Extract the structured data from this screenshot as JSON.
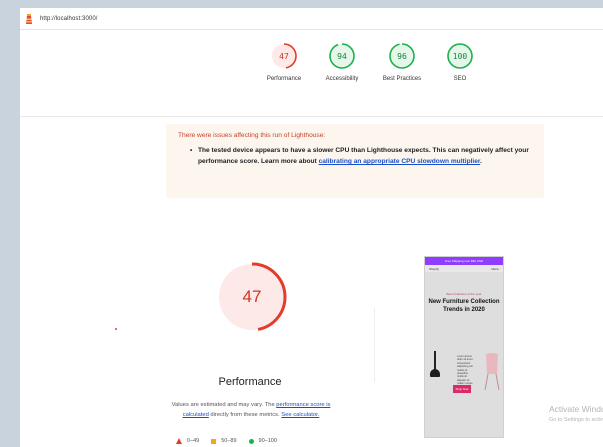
{
  "address_bar": {
    "url": "http://localhost:3000/"
  },
  "colors": {
    "fail": "#e43b2c",
    "average": "#f5a524",
    "pass": "#19b34a"
  },
  "gauges": [
    {
      "label": "Performance",
      "score": "47",
      "status": "fail"
    },
    {
      "label": "Accessibility",
      "score": "94",
      "status": "pass"
    },
    {
      "label": "Best Practices",
      "score": "96",
      "status": "pass"
    },
    {
      "label": "SEO",
      "score": "100",
      "status": "pass"
    }
  ],
  "warning": {
    "title": "There were issues affecting this run of Lighthouse:",
    "text": "The tested device appears to have a slower CPU than Lighthouse expects. This can negatively affect your performance score. Learn more about ",
    "link": "calibrating an appropriate CPU slowdown multiplier",
    "end": "."
  },
  "performance": {
    "score": "47",
    "title": "Performance",
    "note_1": "Values are estimated and may vary. The ",
    "note_link_1": "performance score is calculated",
    "note_2": " directly from these metrics. ",
    "note_link_2": "See calculator."
  },
  "legend": [
    {
      "icon": "triangle-icon",
      "range": "0–49"
    },
    {
      "icon": "square-icon",
      "range": "50–89"
    },
    {
      "icon": "circle-icon",
      "range": "90–100"
    }
  ],
  "screenshot": {
    "banner": "Free Shipping over $50 USD",
    "brand": "Shopify",
    "nav": "Menu",
    "subtitle": "Best Collection of the year",
    "heading": "New Furniture Collection Trends in 2020",
    "body": "Lorem ipsum dolor sit amet consectetur adipiscing elit mattis sit phasellus mollis sit aliquam sit nullam neque ultrices.",
    "button": "Shop Now"
  },
  "watermark": {
    "line1": "Activate Windows",
    "line2": "Go to Settings to activate Windows."
  }
}
